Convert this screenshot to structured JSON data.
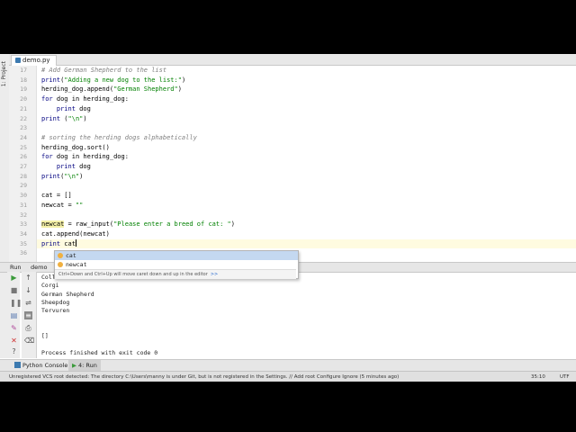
{
  "editor": {
    "tab_label": "demo.py",
    "tool_window_label": "1: Project",
    "lines": [
      {
        "num": "17",
        "text": "# Add German Shepherd to the list",
        "type": "comment"
      },
      {
        "num": "18",
        "text": "print(\"Adding a new dog to the list:\")",
        "type": "code"
      },
      {
        "num": "19",
        "text": "herding_dog.append(\"German Shepherd\")",
        "type": "code"
      },
      {
        "num": "20",
        "text": "for dog in herding_dog:",
        "type": "code"
      },
      {
        "num": "21",
        "text": "    print dog",
        "type": "code"
      },
      {
        "num": "22",
        "text": "print (\"\\n\")",
        "type": "code"
      },
      {
        "num": "23",
        "text": "",
        "type": "code"
      },
      {
        "num": "24",
        "text": "# sorting the herding dogs alphabetically",
        "type": "comment"
      },
      {
        "num": "25",
        "text": "herding_dog.sort()",
        "type": "code"
      },
      {
        "num": "26",
        "text": "for dog in herding_dog:",
        "type": "code"
      },
      {
        "num": "27",
        "text": "    print dog",
        "type": "code"
      },
      {
        "num": "28",
        "text": "print(\"\\n\")",
        "type": "code"
      },
      {
        "num": "29",
        "text": "",
        "type": "code"
      },
      {
        "num": "30",
        "text": "cat = []",
        "type": "code"
      },
      {
        "num": "31",
        "text": "newcat = \"\"",
        "type": "code"
      },
      {
        "num": "32",
        "text": "",
        "type": "code"
      },
      {
        "num": "33",
        "text": "newcat = raw_input(\"Please enter a breed of cat: \")",
        "type": "code"
      },
      {
        "num": "34",
        "text": "cat.append(newcat)",
        "type": "code"
      },
      {
        "num": "35",
        "text": "print cat",
        "type": "current"
      },
      {
        "num": "36",
        "text": "",
        "type": "code"
      }
    ]
  },
  "autocomplete": {
    "items": [
      "cat",
      "newcat"
    ],
    "hint": "Ctrl+Down and Ctrl+Up will move caret down and up in the editor",
    "hint_link": ">>"
  },
  "run_panel": {
    "label": "Run",
    "config": "demo",
    "output_lines": [
      "Coll",
      "Corgi",
      "German Shepherd",
      "Sheepdog",
      "Tervuren",
      "",
      "",
      "[]",
      "",
      "Process finished with exit code 0"
    ]
  },
  "bottom_tabs": {
    "python_console": "Python Console",
    "run": "4: Run"
  },
  "status": {
    "message": "Unregistered VCS root detected: The directory C:\\Users\\manny is under Git, but is not registered in the Settings. // Add root  Configure  Ignore (5 minutes ago)",
    "position": "35:10",
    "encoding": "UTF"
  },
  "colors": {
    "accent": "#c4d8f0",
    "current_line": "#fffbe0",
    "string": "#008000",
    "comment": "#808080"
  }
}
